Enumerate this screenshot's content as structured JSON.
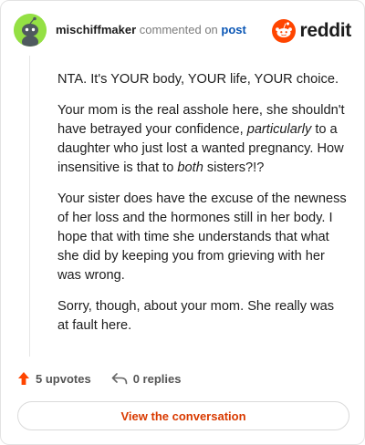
{
  "comment": {
    "username": "mischiffmaker",
    "commented_on": "commented on",
    "post_link": "post",
    "paragraphs": [
      [
        {
          "t": "NTA. It's YOUR body, YOUR life, YOUR choice."
        }
      ],
      [
        {
          "t": "Your mom is the real asshole here, she shouldn't have betrayed your confidence, "
        },
        {
          "t": "particularly",
          "i": true
        },
        {
          "t": " to a daughter who just lost a wanted pregnancy. How insensitive is that to "
        },
        {
          "t": "both",
          "i": true
        },
        {
          "t": " sisters?!?"
        }
      ],
      [
        {
          "t": "Your sister does have the excuse of the newness of her loss and the hormones still in her body. I hope that with time she understands that what she did by keeping you from grieving with her was wrong."
        }
      ],
      [
        {
          "t": "Sorry, though, about your mom. She really was at fault here."
        }
      ]
    ]
  },
  "brand": {
    "wordmark": "reddit",
    "icon": "reddit-logo-icon",
    "color": "#ff4500"
  },
  "footer": {
    "upvotes": "5 upvotes",
    "replies": "0 replies",
    "upvote_icon": "upvote-arrow-icon",
    "reply_icon": "reply-arrow-icon",
    "upvote_color": "#ff4500"
  },
  "cta": {
    "label": "View the conversation"
  },
  "avatar": {
    "icon": "snoo-avatar-icon",
    "background": "#94e044"
  }
}
